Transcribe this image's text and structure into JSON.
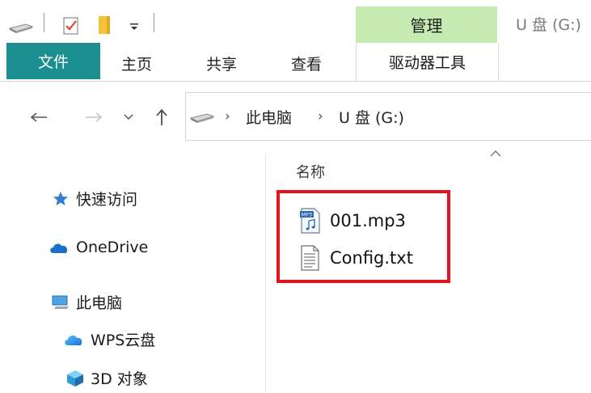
{
  "window": {
    "title": "U 盘 (G:)"
  },
  "context_tab": {
    "header": "管理",
    "tab": "驱动器工具"
  },
  "ribbon": {
    "tabs": [
      "文件",
      "主页",
      "共享",
      "查看"
    ]
  },
  "breadcrumb": [
    "此电脑",
    "U 盘 (G:)"
  ],
  "nav_pane": {
    "items": [
      {
        "label": "快速访问",
        "icon": "star-icon"
      },
      {
        "label": "OneDrive",
        "icon": "cloud-icon"
      },
      {
        "label": "此电脑",
        "icon": "computer-icon"
      },
      {
        "label": "WPS云盘",
        "icon": "cloud-icon"
      },
      {
        "label": "3D 对象",
        "icon": "cube-icon"
      }
    ]
  },
  "file_list": {
    "column_name": "名称",
    "files": [
      {
        "name": "001.mp3",
        "icon": "mp3-file-icon"
      },
      {
        "name": "Config.txt",
        "icon": "text-file-icon"
      }
    ]
  },
  "colors": {
    "file_tab_bg": "#1b8f8f",
    "context_header_bg": "#c5eab2",
    "highlight_border": "#e5141c"
  }
}
